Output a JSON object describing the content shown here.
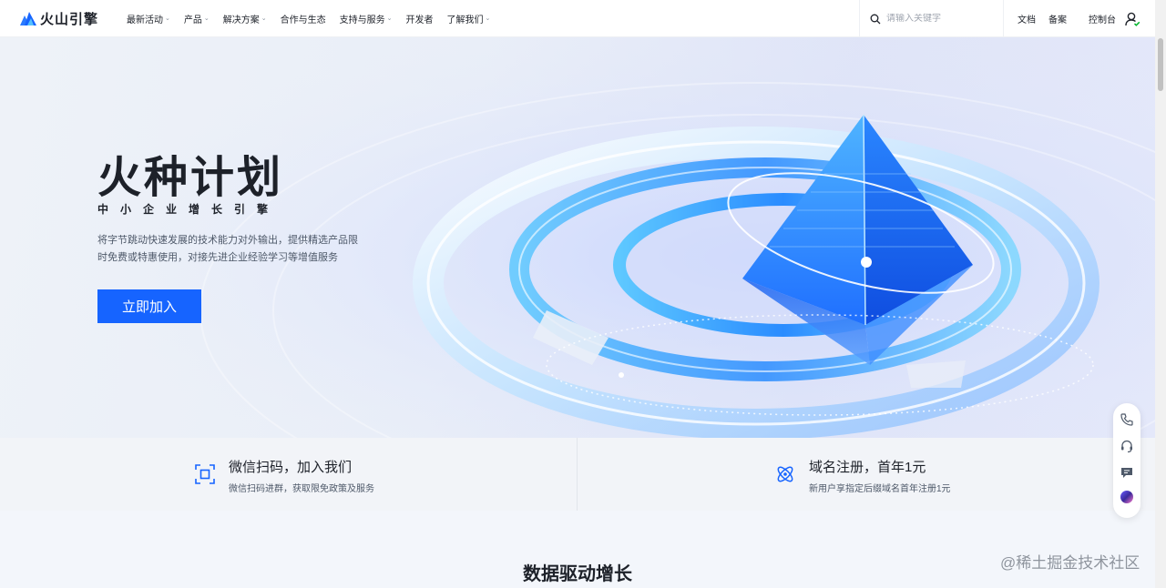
{
  "header": {
    "brand": "火山引擎",
    "nav": [
      {
        "label": "最新活动",
        "dropdown": true
      },
      {
        "label": "产品",
        "dropdown": true
      },
      {
        "label": "解决方案",
        "dropdown": true
      },
      {
        "label": "合作与生态",
        "dropdown": false
      },
      {
        "label": "支持与服务",
        "dropdown": true
      },
      {
        "label": "开发者",
        "dropdown": false
      },
      {
        "label": "了解我们",
        "dropdown": true
      }
    ],
    "search_placeholder": "请输入关键字",
    "links": {
      "docs": "文档",
      "filing": "备案",
      "console": "控制台"
    },
    "icons": {
      "logo": "volcano-logo-icon",
      "search": "search-icon",
      "user": "user-icon",
      "chevron": "chevron-down-icon"
    }
  },
  "hero": {
    "title": "火种计划",
    "subtitle": "中小企业增长引擎",
    "description": "将字节跳动快速发展的技术能力对外输出，提供精选产品限时免费或特惠使用，对接先进企业经验学习等增值服务",
    "cta": "立即加入"
  },
  "features": [
    {
      "icon": "scan-icon",
      "title": "微信扫码，加入我们",
      "desc": "微信扫码进群，获取限免政策及服务"
    },
    {
      "icon": "atom-icon",
      "title": "域名注册，首年1元",
      "desc": "新用户享指定后缀域名首年注册1元"
    }
  ],
  "side_toolbar": [
    "phone-icon",
    "headset-icon",
    "chat-icon",
    "assistant-orb-icon"
  ],
  "section": {
    "title": "数据驱动增长"
  },
  "watermark": "@稀土掘金技术社区",
  "colors": {
    "accent": "#1664ff",
    "text": "#1d2129",
    "muted": "#4e5969"
  }
}
